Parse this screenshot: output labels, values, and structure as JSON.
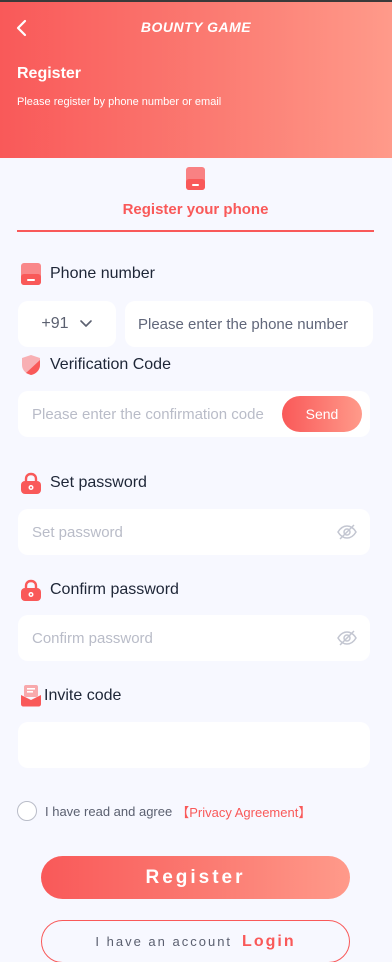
{
  "header": {
    "logo_text": "BOUNTY GAME",
    "title": "Register",
    "subtitle": "Please register by phone number or email"
  },
  "tab": {
    "label": "Register your phone"
  },
  "phone": {
    "label": "Phone number",
    "country_code": "+91",
    "placeholder": "Please enter the phone number"
  },
  "verification": {
    "label": "Verification Code",
    "placeholder": "Please enter the confirmation code",
    "send_label": "Send"
  },
  "password": {
    "label": "Set password",
    "placeholder": "Set password"
  },
  "confirm_password": {
    "label": "Confirm password",
    "placeholder": "Confirm password"
  },
  "invite": {
    "label": "Invite code",
    "placeholder": ""
  },
  "agreement": {
    "text": "I have read and agree",
    "link": "【Privacy Agreement】"
  },
  "actions": {
    "register_label": "Register",
    "have_account": "I have an account",
    "login_label": "Login"
  },
  "colors": {
    "accent": "#f95959",
    "accent_light": "#ff9a8a",
    "background": "#f7f8ff"
  }
}
